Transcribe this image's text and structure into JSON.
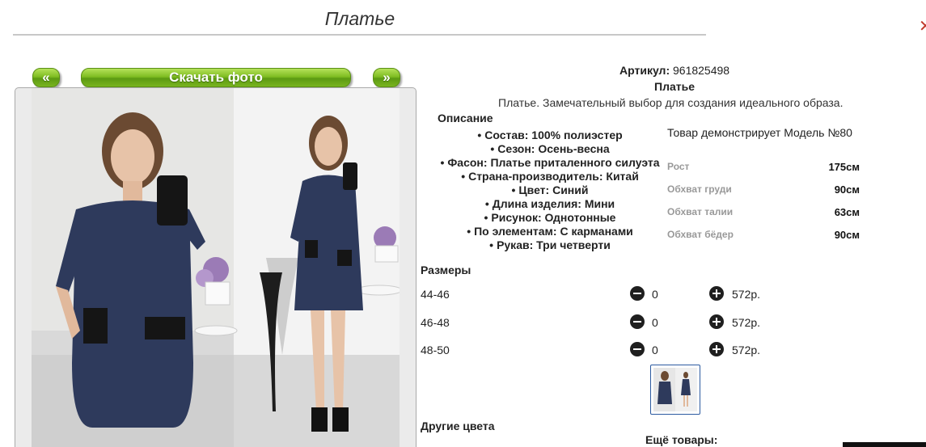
{
  "page": {
    "title": "Платье"
  },
  "gallery": {
    "prev_label": "«",
    "download_label": "Скачать фото",
    "next_label": "»",
    "photo_alt": "Платье"
  },
  "product": {
    "article_label": "Артикул:",
    "article_value": "961825498",
    "name": "Платье",
    "description": "Платье. Замечательный выбор для создания идеального образа.",
    "description_title": "Описание",
    "features": [
      "Состав: 100% полиэстер",
      "Сезон: Осень-весна",
      "Фасон: Платье приталенного силуэта",
      "Страна-производитель: Китай",
      "Цвет: Синий",
      "Длина изделия: Мини",
      "Рисунок: Однотонные",
      "По элементам: С карманами",
      "Рукав: Три четверти"
    ],
    "bullet": "•"
  },
  "model": {
    "note": "Товар демонстрирует Модель №80",
    "measures": [
      {
        "label": "Рост",
        "value": "175см"
      },
      {
        "label": "Обхват груди",
        "value": "90см"
      },
      {
        "label": "Обхват талии",
        "value": "63см"
      },
      {
        "label": "Обхват бёдер",
        "value": "90см"
      }
    ]
  },
  "sizes": {
    "title": "Размеры",
    "rows": [
      {
        "size": "44-46",
        "qty": "0",
        "price": "572р."
      },
      {
        "size": "46-48",
        "qty": "0",
        "price": "572р."
      },
      {
        "size": "48-50",
        "qty": "0",
        "price": "572р."
      }
    ]
  },
  "other_colors_title": "Другие цвета",
  "more_goods_title": "Ещё товары:",
  "colors": {
    "accent_green": "#7fbd22",
    "thumb_border": "#2c5aa0",
    "dress_navy": "#2e3a5c"
  },
  "icons": {
    "minus": "minus-circle-icon",
    "plus": "plus-circle-icon"
  }
}
